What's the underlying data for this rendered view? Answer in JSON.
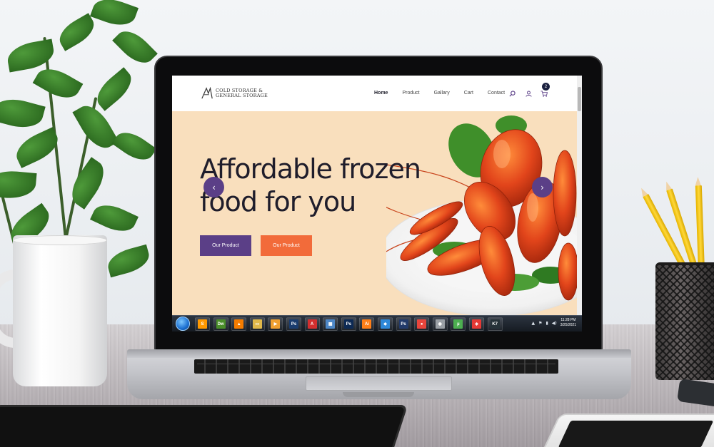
{
  "site": {
    "logo_text_line1": "COLD STORAGE &",
    "logo_text_line2": "GENERAL STORAGE",
    "nav": [
      {
        "label": "Home",
        "active": true
      },
      {
        "label": "Product",
        "active": false
      },
      {
        "label": "Gallary",
        "active": false
      },
      {
        "label": "Cart",
        "active": false
      },
      {
        "label": "Contact",
        "active": false
      }
    ],
    "cart_count": "2",
    "hero": {
      "title_line1": "Affordable frozen",
      "title_line2": "food for you",
      "primary_button": "Our Product",
      "secondary_button": "Our Product",
      "prev_arrow": "‹",
      "next_arrow": "›"
    },
    "colors": {
      "hero_bg": "#f9dfbd",
      "primary": "#5b3f87",
      "secondary": "#f26b3a",
      "text_dark": "#1f1d2b"
    }
  },
  "taskbar": {
    "apps": [
      {
        "icon": "sublime-icon",
        "label": "S",
        "color": "#ff9800"
      },
      {
        "icon": "dreamweaver-icon",
        "label": "Dw",
        "color": "#4a8f2a"
      },
      {
        "icon": "vlc-icon",
        "label": "▲",
        "color": "#f57c00"
      },
      {
        "icon": "file-explorer-icon",
        "label": "▭",
        "color": "#e0b84a"
      },
      {
        "icon": "media-player-icon",
        "label": "▶",
        "color": "#f0a030"
      },
      {
        "icon": "photoshop-icon",
        "label": "Ps",
        "color": "#1a3c6e"
      },
      {
        "icon": "acrobat-icon",
        "label": "A",
        "color": "#d32f2f"
      },
      {
        "icon": "photo-viewer-icon",
        "label": "▦",
        "color": "#4d87c7"
      },
      {
        "icon": "photoshop-icon",
        "label": "Ps",
        "color": "#0d2a55"
      },
      {
        "icon": "illustrator-icon",
        "label": "Ai",
        "color": "#ff7f18"
      },
      {
        "icon": "network-icon",
        "label": "◆",
        "color": "#2e88d8"
      },
      {
        "icon": "photoshop-icon",
        "label": "Ps",
        "color": "#223a6a"
      },
      {
        "icon": "chrome-icon",
        "label": "●",
        "color": "#e8453c"
      },
      {
        "icon": "eye-icon",
        "label": "◉",
        "color": "#9aa0a6"
      },
      {
        "icon": "utorrent-icon",
        "label": "µ",
        "color": "#4caf50"
      },
      {
        "icon": "anydesk-icon",
        "label": "◈",
        "color": "#e53935"
      },
      {
        "icon": "k7-icon",
        "label": "K7",
        "color": "#263238"
      }
    ],
    "time": "11:28 PM",
    "date": "3/25/2021"
  }
}
